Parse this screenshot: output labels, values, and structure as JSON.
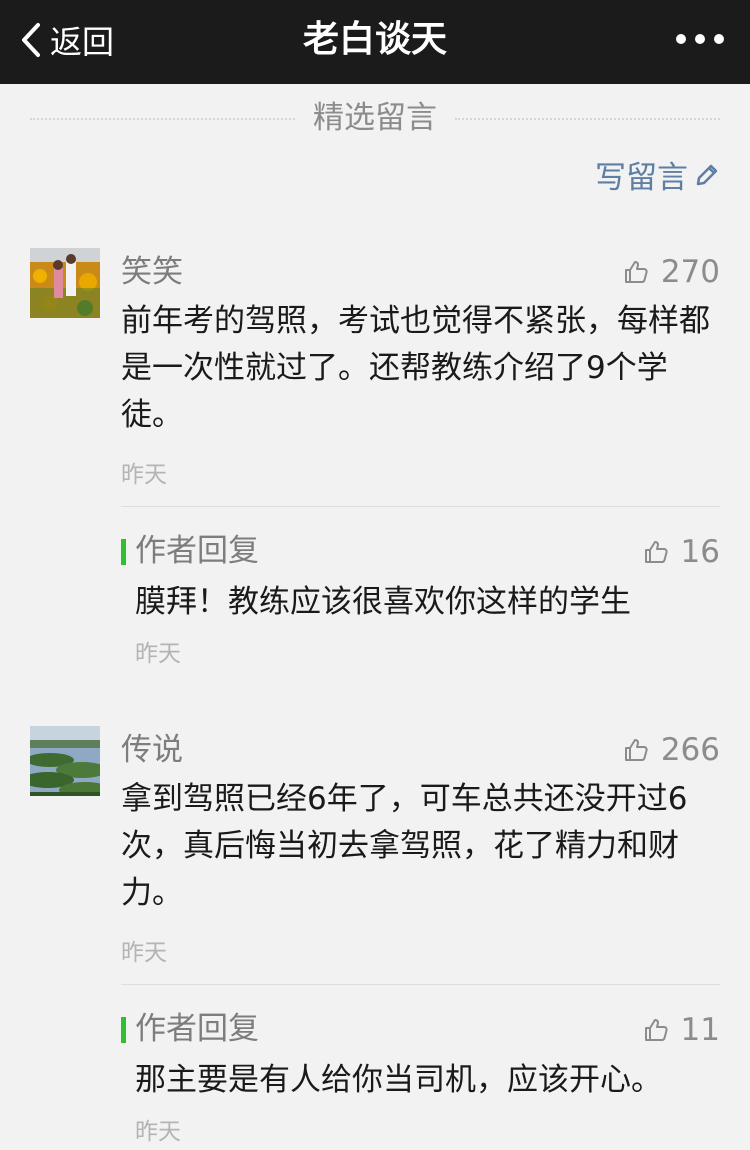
{
  "nav": {
    "back_label": "返回",
    "title": "老白谈天"
  },
  "section": {
    "title": "精选留言"
  },
  "write_label": "写留言",
  "comments": [
    {
      "nickname": "笑笑",
      "likes": "270",
      "content": "前年考的驾照，考试也觉得不紧张，每样都是一次性就过了。还帮教练介绍了9个学徒。",
      "time": "昨天",
      "reply": {
        "label": "作者回复",
        "likes": "16",
        "content": "膜拜！教练应该很喜欢你这样的学生",
        "time": "昨天"
      }
    },
    {
      "nickname": "传说",
      "likes": "266",
      "content": "拿到驾照已经6年了，可车总共还没开过6次，真后悔当初去拿驾照，花了精力和财力。",
      "time": "昨天",
      "reply": {
        "label": "作者回复",
        "likes": "11",
        "content": "那主要是有人给你当司机，应该开心。",
        "time": "昨天"
      }
    }
  ],
  "colors": {
    "navbar": "#1b1b1b",
    "background": "#f2f2f2",
    "link": "#5f7ea3",
    "reply_bar": "#2ec02e"
  },
  "icons": [
    "chevron-left-icon",
    "more-dots-icon",
    "pencil-icon",
    "thumbs-up-icon"
  ]
}
